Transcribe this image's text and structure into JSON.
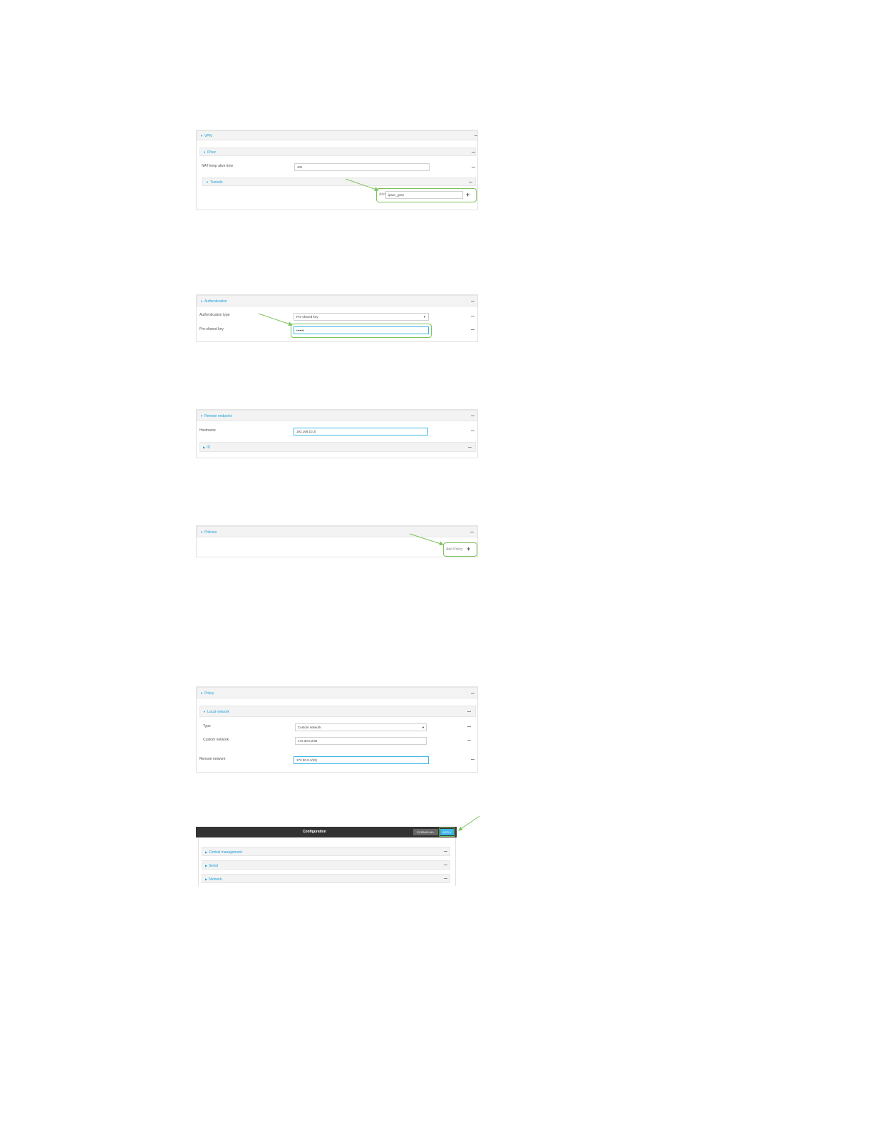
{
  "shot1": {
    "vpn": "VPN",
    "ipsec": "IPsec",
    "nat_label": "NAT keep alive time",
    "nat_value": "40s",
    "tunnels": "Tunnels",
    "add_label": "Add",
    "add_value": "ipsec_gre2"
  },
  "shot2": {
    "authentication": "Authentication",
    "auth_type_label": "Authentication type",
    "auth_type_value": "Pre-shared key",
    "psk_label": "Pre-shared key",
    "psk_value": "••••••|"
  },
  "shot3": {
    "remote_endpoint": "Remote endpoint",
    "hostname_label": "Hostname",
    "hostname_value": "192.168.10.2|",
    "id": "ID"
  },
  "shot4": {
    "policies": "Policies",
    "add_policy": "Add Policy"
  },
  "shot5": {
    "policy": "Policy",
    "local_network": "Local network",
    "type_label": "Type",
    "type_value": "Custom network",
    "custom_label": "Custom network",
    "custom_value": "172.30.0.2/32",
    "remote_label": "Remote network",
    "remote_value": "172.30.0.1/32|"
  },
  "shot6": {
    "title": "Configuration",
    "expand_all": "EXPAND ALL",
    "apply": "APPLY",
    "items": [
      "Central management",
      "Serial",
      "Network"
    ]
  },
  "colors": {
    "accent": "#1ea1dc",
    "highlight": "#7cc15a",
    "toolbar": "#333333",
    "apply": "#3fb8e6"
  }
}
